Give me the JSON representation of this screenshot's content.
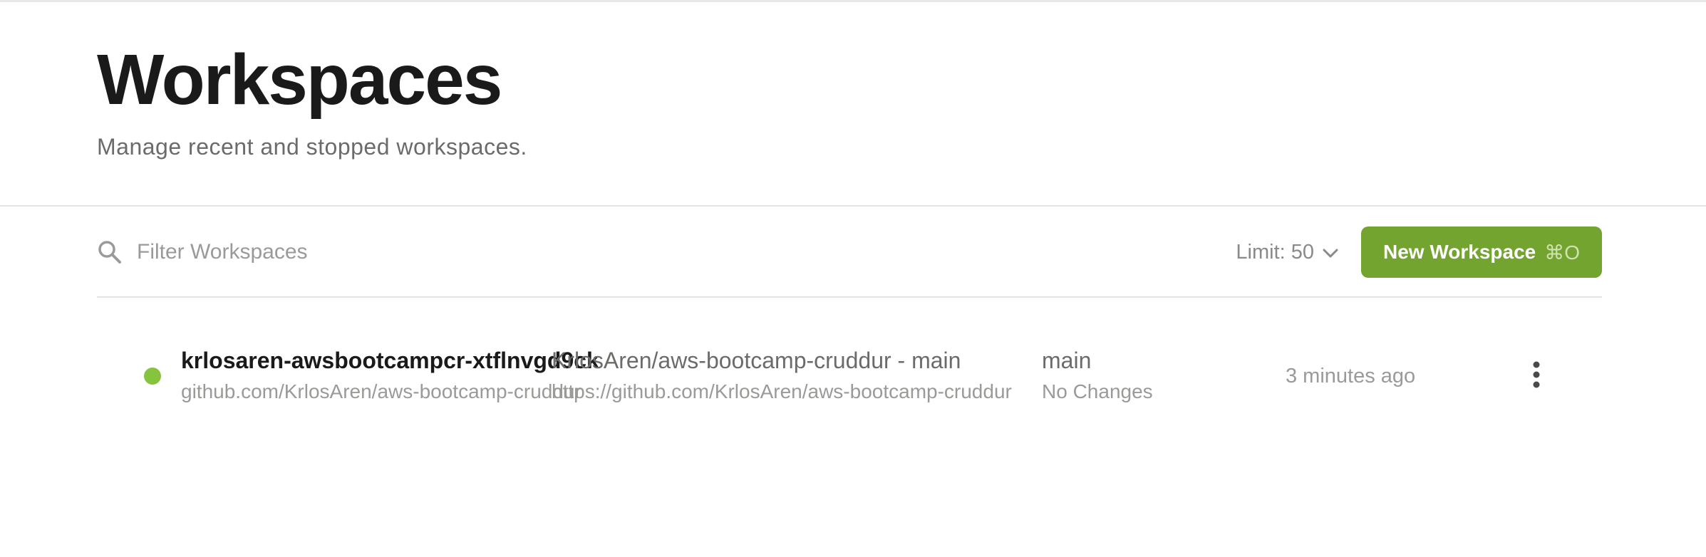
{
  "page": {
    "title": "Workspaces",
    "subtitle": "Manage recent and stopped workspaces."
  },
  "toolbar": {
    "search_placeholder": "Filter Workspaces",
    "search_value": "",
    "search_icon": "search-icon",
    "limit_label": "Limit: 50",
    "limit_icon": "chevron-down-icon",
    "new_workspace_label": "New Workspace",
    "new_workspace_shortcut": "⌘O",
    "accent_color": "#74a430"
  },
  "workspaces": [
    {
      "name": "krlosaren-awsbootcampcr-xtflnvgd9ck",
      "repo_host_path": "github.com/KrlosAren/aws-bootcamp-cruddur",
      "context_title": "KrlosAren/aws-bootcamp-cruddur - main",
      "context_url": "https://github.com/KrlosAren/aws-bootcamp-cruddur",
      "branch": "main",
      "changes": "No Changes",
      "last_active": "3 minutes ago",
      "status_color": "#86c440",
      "menu_icon": "more-vertical-icon"
    }
  ]
}
